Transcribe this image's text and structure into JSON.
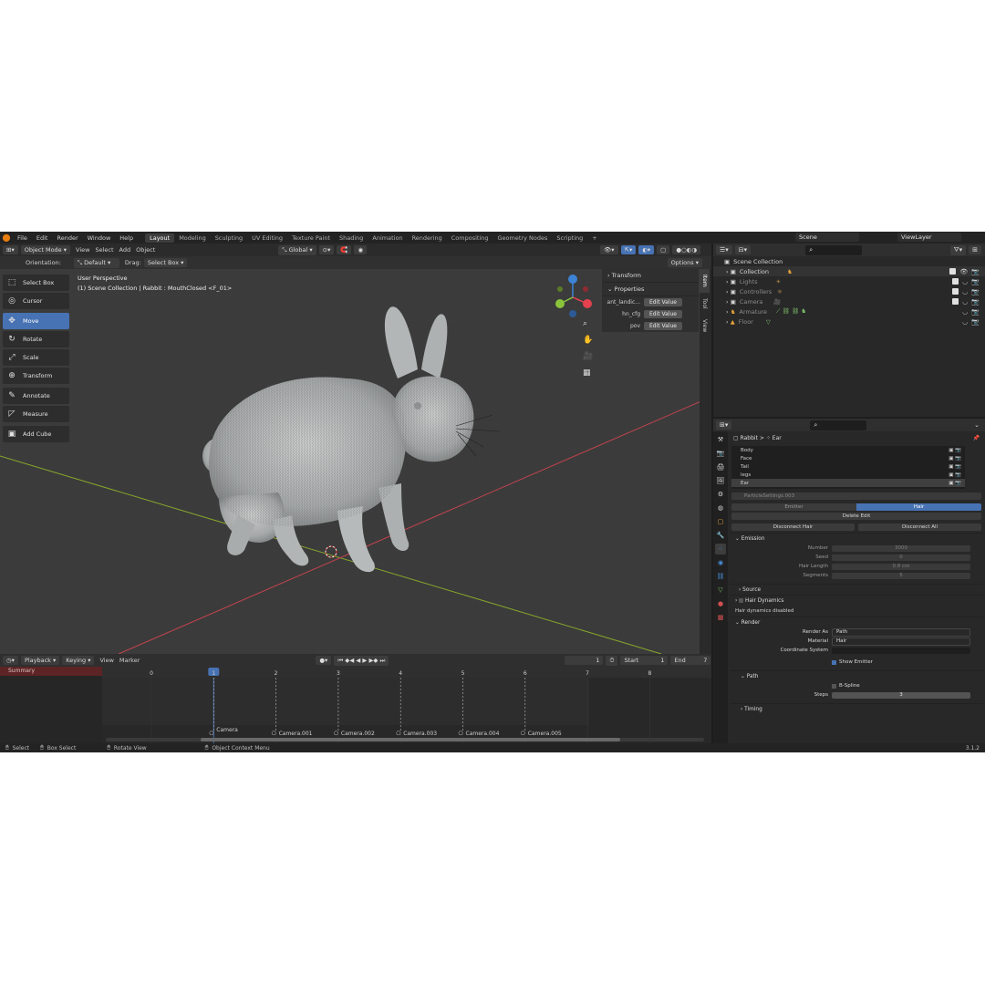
{
  "menubar": {
    "items": [
      "File",
      "Edit",
      "Render",
      "Window",
      "Help"
    ],
    "workspaces": [
      "Layout",
      "Modeling",
      "Sculpting",
      "UV Editing",
      "Texture Paint",
      "Shading",
      "Animation",
      "Rendering",
      "Compositing",
      "Geometry Nodes",
      "Scripting"
    ],
    "active_workspace": "Layout",
    "add_tab": "+",
    "scene": "Scene",
    "viewlayer": "ViewLayer"
  },
  "viewport": {
    "mode": "Object Mode",
    "menus": [
      "View",
      "Select",
      "Add",
      "Object"
    ],
    "transform_orientation": "Global",
    "orientation_label": "Orientation:",
    "orientation_value": "Default",
    "drag_label": "Drag:",
    "drag_value": "Select Box",
    "options": "Options",
    "info_line1": "User Perspective",
    "info_line2": "(1) Scene Collection | Rabbit : MouthClosed <F_01>"
  },
  "toolbar": {
    "tools": [
      {
        "label": "Select Box",
        "icon": "select-box-icon",
        "glyph": "⬚"
      },
      {
        "label": "Cursor",
        "icon": "cursor-icon",
        "glyph": "◎"
      },
      {
        "label": "Move",
        "icon": "move-icon",
        "glyph": "✥"
      },
      {
        "label": "Rotate",
        "icon": "rotate-icon",
        "glyph": "↻"
      },
      {
        "label": "Scale",
        "icon": "scale-icon",
        "glyph": "⤢"
      },
      {
        "label": "Transform",
        "icon": "transform-icon",
        "glyph": "⊕"
      },
      {
        "label": "Annotate",
        "icon": "annotate-icon",
        "glyph": "✎"
      },
      {
        "label": "Measure",
        "icon": "measure-icon",
        "glyph": "📐"
      },
      {
        "label": "Add Cube",
        "icon": "add-cube-icon",
        "glyph": "▣"
      }
    ],
    "active": "Move"
  },
  "npanel": {
    "transform": "Transform",
    "properties": "Properties",
    "rows": [
      {
        "label": "ant_landic...",
        "button": "Edit Value"
      },
      {
        "label": "hn_cfg",
        "button": "Edit Value"
      },
      {
        "label": "pov",
        "button": "Edit Value"
      }
    ],
    "tabs": [
      "Item",
      "Tool",
      "View"
    ]
  },
  "timeline": {
    "menus": [
      "Playback",
      "Keying",
      "View",
      "Marker"
    ],
    "current_frame": "1",
    "start_label": "Start",
    "start": "1",
    "end_label": "End",
    "end": "7",
    "ruler": [
      "0",
      "1",
      "2",
      "3",
      "4",
      "5",
      "6",
      "7",
      "8"
    ],
    "summary": "Summary",
    "markers": [
      "Camera",
      "Camera.001",
      "Camera.002",
      "Camera.003",
      "Camera.004",
      "Camera.005"
    ]
  },
  "statusbar": {
    "items": [
      "Select",
      "Box Select",
      "Rotate View",
      "Object Context Menu"
    ],
    "version": "3.1.2"
  },
  "outliner": {
    "root": "Scene Collection",
    "rows": [
      {
        "name": "Collection",
        "color": "#e0e0e0",
        "dim": false
      },
      {
        "name": "Lights",
        "color": "#8c8c8c",
        "dim": true
      },
      {
        "name": "Controllers",
        "color": "#8c8c8c",
        "dim": true
      },
      {
        "name": "Camera",
        "color": "#8c8c8c",
        "dim": true
      },
      {
        "name": "Armature",
        "color": "#8c8c8c",
        "dim": true
      },
      {
        "name": "Floor",
        "color": "#8c8c8c",
        "dim": true
      }
    ]
  },
  "properties": {
    "breadcrumb_object": "Rabbit",
    "breadcrumb_sep": ">",
    "breadcrumb_system": "Ear",
    "systems": [
      "Body",
      "Face",
      "Tail",
      "legs",
      "Ear"
    ],
    "active_system": "Ear",
    "settings_name": "ParticleSettings.003",
    "type_emitter": "Emitter",
    "type_hair": "Hair",
    "delete_edit": "Delete Edit",
    "disconnect_hair": "Disconnect Hair",
    "disconnect_all": "Disconnect All",
    "emission": "Emission",
    "emission_fields": [
      {
        "label": "Number",
        "value": "3000"
      },
      {
        "label": "Seed",
        "value": "0"
      },
      {
        "label": "Hair Length",
        "value": "0.8 cm"
      },
      {
        "label": "Segments",
        "value": "5"
      }
    ],
    "source": "Source",
    "hair_dynamics": "Hair Dynamics",
    "hair_dynamics_note": "Hair dynamics disabled",
    "render": "Render",
    "render_fields": [
      {
        "label": "Render As",
        "value": "Path"
      },
      {
        "label": "Material",
        "value": "Hair"
      },
      {
        "label": "Coordinate System",
        "value": ""
      }
    ],
    "show_emitter": "Show Emitter",
    "path": "Path",
    "bspline": "B-Spline",
    "steps_label": "Steps",
    "steps": "3",
    "timing": "Timing"
  },
  "colors": {
    "accent": "#4772b3",
    "x_axis": "#c2434e",
    "y_axis": "#86a62b",
    "gizmo_x": "#e5414f",
    "gizmo_y": "#8ac43b",
    "gizmo_z": "#3c83d6",
    "fur": "#b9bbbb"
  }
}
